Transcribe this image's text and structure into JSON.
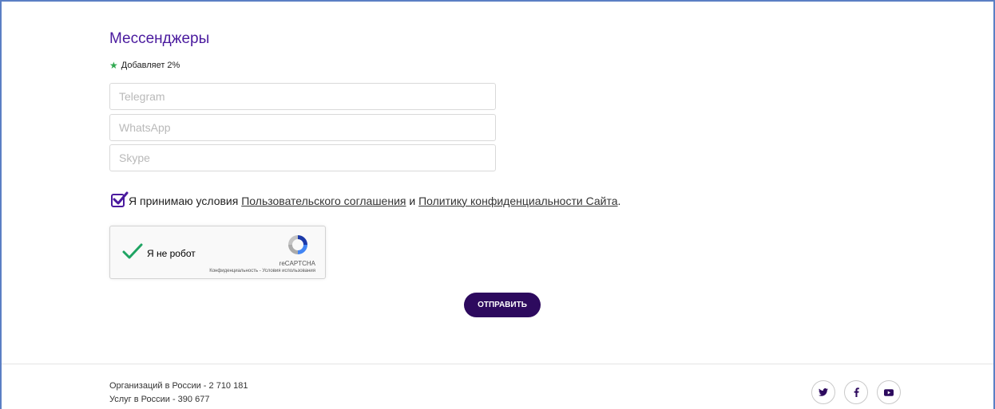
{
  "section": {
    "title": "Мессенджеры",
    "bonus": "Добавляет 2%"
  },
  "fields": {
    "telegram_placeholder": "Telegram",
    "whatsapp_placeholder": "WhatsApp",
    "skype_placeholder": "Skype"
  },
  "agreement": {
    "prefix": "Я принимаю условия",
    "link1": "Пользовательского соглашения",
    "conj": "и",
    "link2": "Политику конфиденциальности Сайта",
    "suffix": ".",
    "checked": true
  },
  "recaptcha": {
    "label": "Я не робот",
    "brand": "reCAPTCHA",
    "terms": "Конфиденциальность - Условия использования",
    "checked": true
  },
  "submit_label": "ОТПРАВИТЬ",
  "footer": {
    "stat_org": "Организаций в России - 2 710 181",
    "stat_svc": "Услуг в России - 390 677",
    "social": [
      "twitter-icon",
      "facebook-icon",
      "youtube-icon"
    ]
  },
  "colors": {
    "accent": "#4a1a9e",
    "button": "#2d0a5e",
    "star": "#2fa84f",
    "check": "#1fa463"
  }
}
